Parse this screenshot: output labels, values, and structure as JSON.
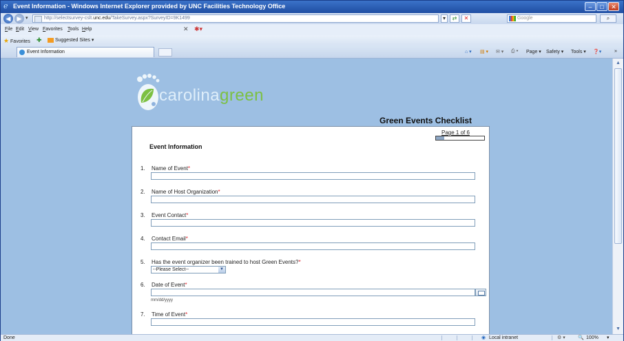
{
  "window": {
    "title": "Event Information - Windows Internet Explorer provided by UNC Facilities Technology Office",
    "min_glyph": "–",
    "max_glyph": "□",
    "close_glyph": "✕"
  },
  "address_bar": {
    "url_prefix": "http://selectsurvey-cslt.",
    "url_domain": "unc.edu",
    "url_suffix": "/TakeSurvey.aspx?SurveyID=9K1499",
    "refresh_glyph": "⇄",
    "stop_glyph": "✕",
    "search_placeholder": "Google",
    "search_btn": "⌕"
  },
  "menu": {
    "items": [
      "File",
      "Edit",
      "View",
      "Favorites",
      "Tools",
      "Help"
    ]
  },
  "favorites_bar": {
    "favorites_label": "Favorites",
    "suggested_label": "Suggested Sites ▾"
  },
  "tab": {
    "label": "Event Information"
  },
  "command_bar": {
    "page": "Page ▾",
    "safety": "Safety ▾",
    "tools": "Tools ▾"
  },
  "page": {
    "logo_text_1": "carolina",
    "logo_text_2": "green",
    "checklist_title": "Green Events Checklist",
    "page_indicator": "Page 1 of 6",
    "progress_fraction": 0.167,
    "section_title": "Event Information",
    "questions": [
      {
        "num": "1.",
        "label": "Name of Event",
        "req": "*"
      },
      {
        "num": "2.",
        "label": "Name of Host Organization",
        "req": "*"
      },
      {
        "num": "3.",
        "label": "Event Contact",
        "req": "*"
      },
      {
        "num": "4.",
        "label": "Contact Email",
        "req": "*"
      },
      {
        "num": "5.",
        "label": "Has the event organizer been trained to host Green Events?",
        "req": "*"
      },
      {
        "num": "6.",
        "label": "Date of Event",
        "req": "*"
      },
      {
        "num": "7.",
        "label": "Time of Event",
        "req": "*"
      }
    ],
    "select_value": "--Please Select--",
    "date_hint": "mm/dd/yyyy"
  },
  "status_bar": {
    "left": "Done",
    "zone": "Local intranet",
    "zoom": "100%"
  },
  "colors": {
    "page_bg": "#9dbfe3",
    "required": "#e0202a",
    "logo_green": "#7cc042"
  }
}
